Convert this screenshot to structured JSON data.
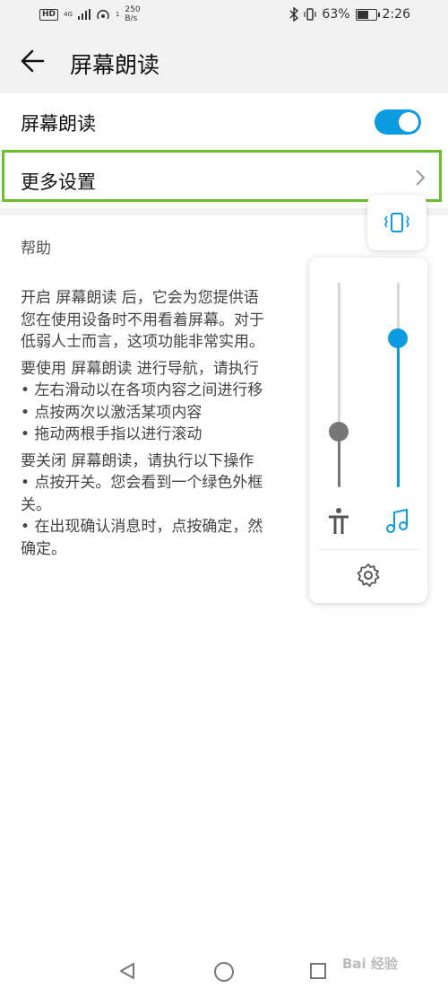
{
  "status_bar": {
    "left_badges": [
      "HD",
      "4G",
      "1"
    ],
    "net_speed_value": "250",
    "net_speed_unit": "B/s",
    "battery_percent": "63%",
    "battery_level": 0.63,
    "time": "2:26"
  },
  "header": {
    "title": "屏幕朗读",
    "back_icon": "arrow-left-icon"
  },
  "settings": {
    "toggle_row_label": "屏幕朗读",
    "toggle_on": true,
    "more_settings_label": "更多设置"
  },
  "help": {
    "title": "帮助",
    "lines": [
      "开启 屏幕朗读 后，它会为您提供语",
      "您在使用设备时不用看着屏幕。对于",
      "低弱人士而言，这项功能非常实用。",
      "要使用 屏幕朗读 进行导航，请执行",
      "• 左右滑动以在各项内容之间进行移",
      "• 点按两次以激活某项内容",
      "• 拖动两根手指以进行滚动",
      "要关闭 屏幕朗读，请执行以下操作",
      "• 点按开关。您会看到一个绿色外框",
      "关。",
      "• 在出现确认消息时，点按确定，然",
      "确定。"
    ]
  },
  "volume_panel": {
    "vibrate_icon": "vibrate-icon",
    "accessibility_level": 0.27,
    "media_level": 0.73,
    "accessibility_icon": "accessibility-icon",
    "music_icon": "music-note-icon",
    "settings_icon": "gear-icon",
    "accent_color": "#0a9be0",
    "inactive_color": "#777777"
  },
  "nav_bar": {
    "icons": [
      "back-triangle-icon",
      "home-circle-icon",
      "recents-square-icon"
    ]
  },
  "watermark": "Bai 经验"
}
